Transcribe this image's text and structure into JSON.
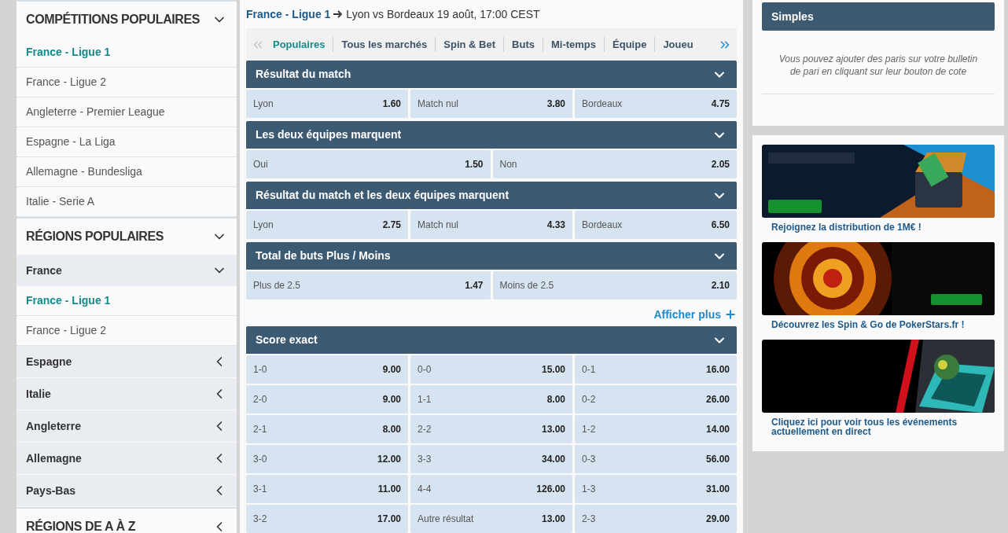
{
  "sidebar": {
    "sections": [
      {
        "title": "COMPÉTITIONS POPULAIRES",
        "expanded": true,
        "items": [
          {
            "kind": "link",
            "label": "France - Ligue 1",
            "selected": true
          },
          {
            "kind": "link",
            "label": "France - Ligue 2",
            "selected": false
          },
          {
            "kind": "link",
            "label": "Angleterre - Premier League",
            "selected": false
          },
          {
            "kind": "link",
            "label": "Espagne - La Liga",
            "selected": false
          },
          {
            "kind": "link",
            "label": "Allemagne - Bundesliga",
            "selected": false
          },
          {
            "kind": "link",
            "label": "Italie - Serie A",
            "selected": false
          }
        ]
      },
      {
        "title": "RÉGIONS POPULAIRES",
        "expanded": true,
        "items": [
          {
            "kind": "region",
            "label": "France",
            "expanded": true,
            "children": [
              {
                "kind": "link",
                "label": "France - Ligue 1",
                "selected": true
              },
              {
                "kind": "link",
                "label": "France - Ligue 2",
                "selected": false
              }
            ]
          },
          {
            "kind": "region",
            "label": "Espagne",
            "expanded": false
          },
          {
            "kind": "region",
            "label": "Italie",
            "expanded": false
          },
          {
            "kind": "region",
            "label": "Angleterre",
            "expanded": false
          },
          {
            "kind": "region",
            "label": "Allemagne",
            "expanded": false
          },
          {
            "kind": "region",
            "label": "Pays-Bas",
            "expanded": false
          }
        ]
      },
      {
        "title": "RÉGIONS DE A À Z",
        "expanded": false
      }
    ]
  },
  "breadcrumb": {
    "link": "France - Ligue 1",
    "event": "Lyon vs Bordeaux 19 août, 17:00 CEST"
  },
  "tabs": [
    {
      "label": "Populaires",
      "selected": true
    },
    {
      "label": "Tous les marchés",
      "selected": false
    },
    {
      "label": "Spin & Bet",
      "selected": false
    },
    {
      "label": "Buts",
      "selected": false
    },
    {
      "label": "Mi-temps",
      "selected": false
    },
    {
      "label": "Équipe",
      "selected": false
    },
    {
      "label": "Joueu",
      "selected": false
    }
  ],
  "tabs_prev_disabled": true,
  "markets": [
    {
      "title": "Résultat du match",
      "expanded": true,
      "rows": [
        [
          {
            "label": "Lyon",
            "odds": "1.60"
          },
          {
            "label": "Match nul",
            "odds": "3.80"
          },
          {
            "label": "Bordeaux",
            "odds": "4.75"
          }
        ]
      ]
    },
    {
      "title": "Les deux équipes marquent",
      "expanded": true,
      "rows": [
        [
          {
            "label": "Oui",
            "odds": "1.50"
          },
          {
            "label": "Non",
            "odds": "2.05"
          }
        ]
      ]
    },
    {
      "title": "Résultat du match et les deux équipes marquent",
      "expanded": true,
      "rows": [
        [
          {
            "label": "Lyon",
            "odds": "2.75"
          },
          {
            "label": "Match nul",
            "odds": "4.33"
          },
          {
            "label": "Bordeaux",
            "odds": "6.50"
          }
        ]
      ]
    },
    {
      "title": "Total de buts Plus / Moins",
      "expanded": true,
      "rows": [
        [
          {
            "label": "Plus de 2.5",
            "odds": "1.47"
          },
          {
            "label": "Moins de 2.5",
            "odds": "2.10"
          }
        ]
      ]
    }
  ],
  "show_more": "Afficher plus",
  "more_markets": [
    {
      "title": "Score exact",
      "expanded": true,
      "rows": [
        [
          {
            "label": "1-0",
            "odds": "9.00"
          },
          {
            "label": "0-0",
            "odds": "15.00"
          },
          {
            "label": "0-1",
            "odds": "16.00"
          }
        ],
        [
          {
            "label": "2-0",
            "odds": "9.00"
          },
          {
            "label": "1-1",
            "odds": "8.00"
          },
          {
            "label": "0-2",
            "odds": "26.00"
          }
        ],
        [
          {
            "label": "2-1",
            "odds": "8.00"
          },
          {
            "label": "2-2",
            "odds": "13.00"
          },
          {
            "label": "1-2",
            "odds": "14.00"
          }
        ],
        [
          {
            "label": "3-0",
            "odds": "12.00"
          },
          {
            "label": "3-3",
            "odds": "34.00"
          },
          {
            "label": "0-3",
            "odds": "56.00"
          }
        ],
        [
          {
            "label": "3-1",
            "odds": "11.00"
          },
          {
            "label": "4-4",
            "odds": "126.00"
          },
          {
            "label": "1-3",
            "odds": "31.00"
          }
        ],
        [
          {
            "label": "3-2",
            "odds": "17.00"
          },
          {
            "label": "Autre résultat",
            "odds": "13.00"
          },
          {
            "label": "2-3",
            "odds": "29.00"
          }
        ]
      ]
    }
  ],
  "betslip": {
    "title": "Simples",
    "message": "Vous pouvez ajouter des paris sur votre bulletin de pari en cliquant sur leur bouton de cote"
  },
  "promos": [
    {
      "kind": "picture",
      "caption": "Rejoignez la distribution de 1M€ !"
    },
    {
      "kind": "picture",
      "caption": "Découvrez les Spin & Go de PokerStars.fr !"
    },
    {
      "kind": "picture",
      "caption": "Cliquez ici pour voir tous les événements actuellement en direct"
    }
  ]
}
